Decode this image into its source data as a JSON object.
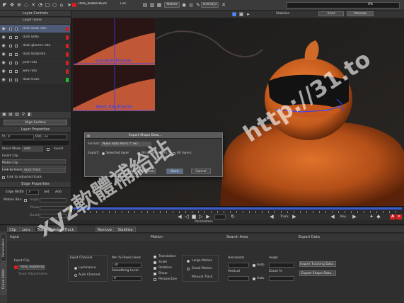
{
  "toolbar": {
    "clip_name": "Roto_RubberDuck",
    "view_option": "Full",
    "mattes_label": "Mattes",
    "overlays_label": "Overlays",
    "stabilize_label": "Stabilize",
    "trace_label": "Trace",
    "preview_label": "Preview",
    "progress_pct": "0%"
  },
  "layer_controls": {
    "title": "Layer Controls",
    "column_header": "Layer name",
    "layers": [
      {
        "name": "duck beak roto",
        "color": "#d42020",
        "selected": true
      },
      {
        "name": "duck belly",
        "color": "#d42020"
      },
      {
        "name": "duck glasses roto",
        "color": "#d42020"
      },
      {
        "name": "duck bodyroto",
        "color": "#d42020"
      },
      {
        "name": "pole roto",
        "color": "#d42020"
      },
      {
        "name": "wire roto",
        "color": "#d42020"
      },
      {
        "name": "duck track",
        "color": "#20c020"
      }
    ]
  },
  "align_surface_label": "Align Surface",
  "layer_properties": {
    "title": "Layer Properties",
    "in_value": "0",
    "out_label": "Out",
    "out_value": "33",
    "blend_mode_label": "Blend Mode",
    "blend_mode_value": "Add",
    "invert_label": "Invert",
    "insert_clip_label": "Insert Clip",
    "matte_clip_label": "Matte Clip",
    "link_to_track_label": "Link to track",
    "link_to_track_value": "duck track",
    "link_adjusted_label": "Link to adjusted track"
  },
  "edge_properties": {
    "title": "Edge Properties",
    "edge_width_label": "Edge Width",
    "edge_width_value": "3",
    "set_label": "Set",
    "add_label": "Add",
    "motion_blur_label": "Motion Blur",
    "angle_label": "Angle",
    "phase_label": "Phase",
    "quality_label": "Quality"
  },
  "viewer": {
    "inset_current_label": "Current Frame",
    "inset_next_label": "Next Keyframe"
  },
  "export_dialog": {
    "title": "Export Shape Data...",
    "format_label": "Format:",
    "format_value": "Nuke Roto Paint (*.nk)",
    "export_label": "Export:",
    "option_selected": "Selected layer",
    "option_all_visible": "All visible layers",
    "option_all": "All layers",
    "copy_button": "Copy to Clipboard",
    "save_button": "Save",
    "cancel_button": "Cancel"
  },
  "timeline": {
    "track_label": "Track",
    "key_label": "Key",
    "parameters_label": "Parameters"
  },
  "bottom_panel": {
    "tabs": [
      "Clip",
      "Lens",
      "Track",
      "AdjustTrack",
      "Remove",
      "Stabilize"
    ],
    "active_tab": "Track",
    "side_tabs": [
      "Parameters",
      "Curve Editor"
    ],
    "sections": {
      "input": "Input",
      "motion": "Motion",
      "search_area": "Search Area",
      "export_data": "Export Data"
    },
    "input_clip_label": "Input Clip",
    "input_clip_value": "Roto_RubberDuck",
    "track_adjustments_label": "Track Adjustments",
    "input_channel_label": "Input Channel",
    "luminance_label": "Luminance",
    "auto_channel_label": "Auto Channel",
    "min_pixels_label": "Min % Pixels Used",
    "min_pixels_value": "30",
    "smoothing_label": "Smoothing Level",
    "smoothing_value": "0",
    "translation_label": "Translation",
    "scale_label": "Scale",
    "rotation_label": "Rotation",
    "shear_label": "Shear",
    "perspective_label": "Perspective",
    "large_motion_label": "Large Motion",
    "small_motion_label": "Small Motion",
    "manual_track_label": "Manual Track",
    "horizontal_label": "Horizontal",
    "vertical_label": "Vertical",
    "auto_label": "Auto",
    "auto_label2": "Auto",
    "angle_label": "Angle",
    "zoom_label": "Zoom %",
    "export_tracking_button": "Export Tracking Data...",
    "export_shape_button": "Export Shape Data..."
  },
  "watermark": {
    "text1": "xyz軟體補給站",
    "text2": "http://31.to"
  },
  "colors": {
    "accent_red": "#d42020",
    "accent_green": "#20c020",
    "panel_bg": "#2f2f2f",
    "timeline_blue": "#3a5bd0",
    "playhead": "#e8e020"
  }
}
